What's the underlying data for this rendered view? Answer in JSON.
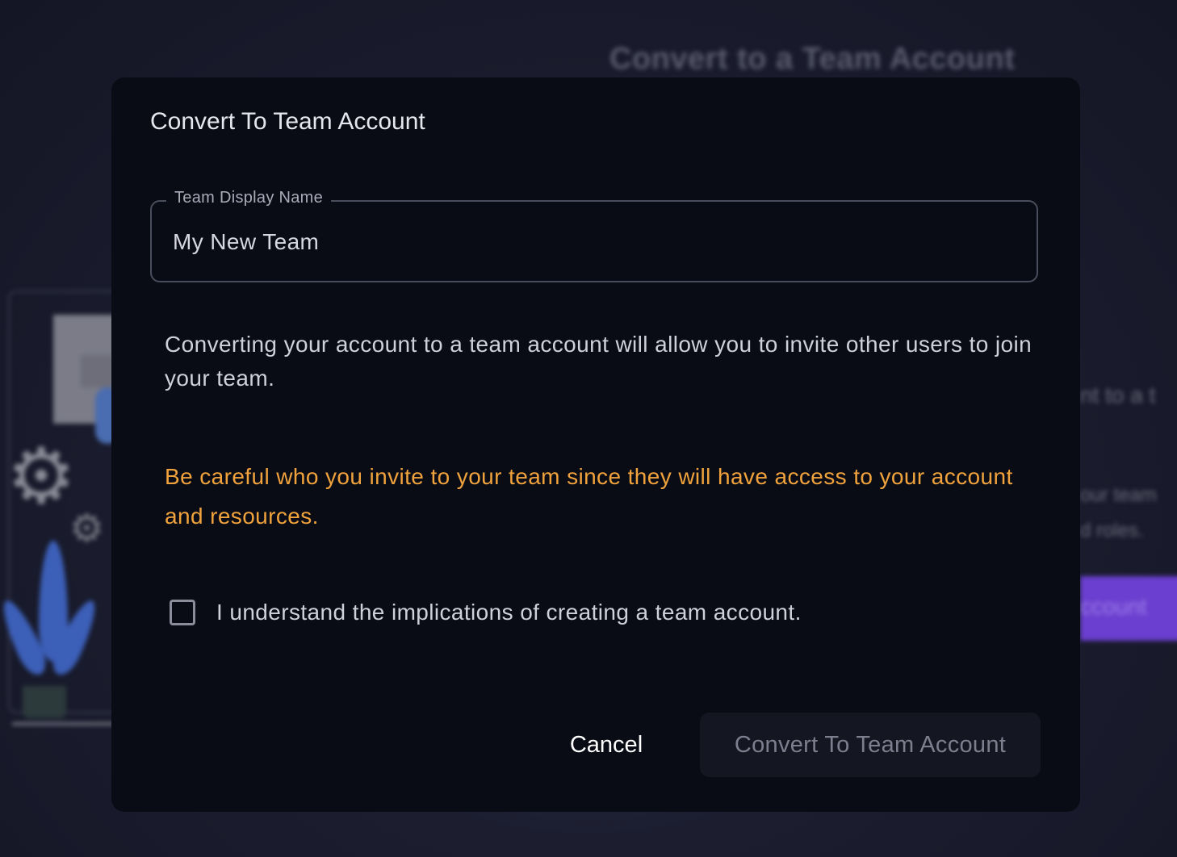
{
  "background": {
    "page_title": "Convert to a Team Account",
    "right_text_1": "nt to a t",
    "right_text_2": "our team",
    "right_text_3": "d roles.",
    "right_button_label": "ccount"
  },
  "modal": {
    "title": "Convert To Team Account",
    "field": {
      "label": "Team Display Name",
      "value": "My New Team"
    },
    "description": "Converting your account to a team account will allow you to invite other users to join your team.",
    "warning": "Be careful who you invite to your team since they will have access to your account and resources.",
    "checkbox": {
      "label": "I understand the implications of creating a team account.",
      "checked": false
    },
    "buttons": {
      "cancel": "Cancel",
      "confirm": "Convert To Team Account"
    }
  },
  "colors": {
    "warning": "#f0a23c",
    "modal_bg": "#0a0c15",
    "accent_purple": "#6b3fcf"
  }
}
